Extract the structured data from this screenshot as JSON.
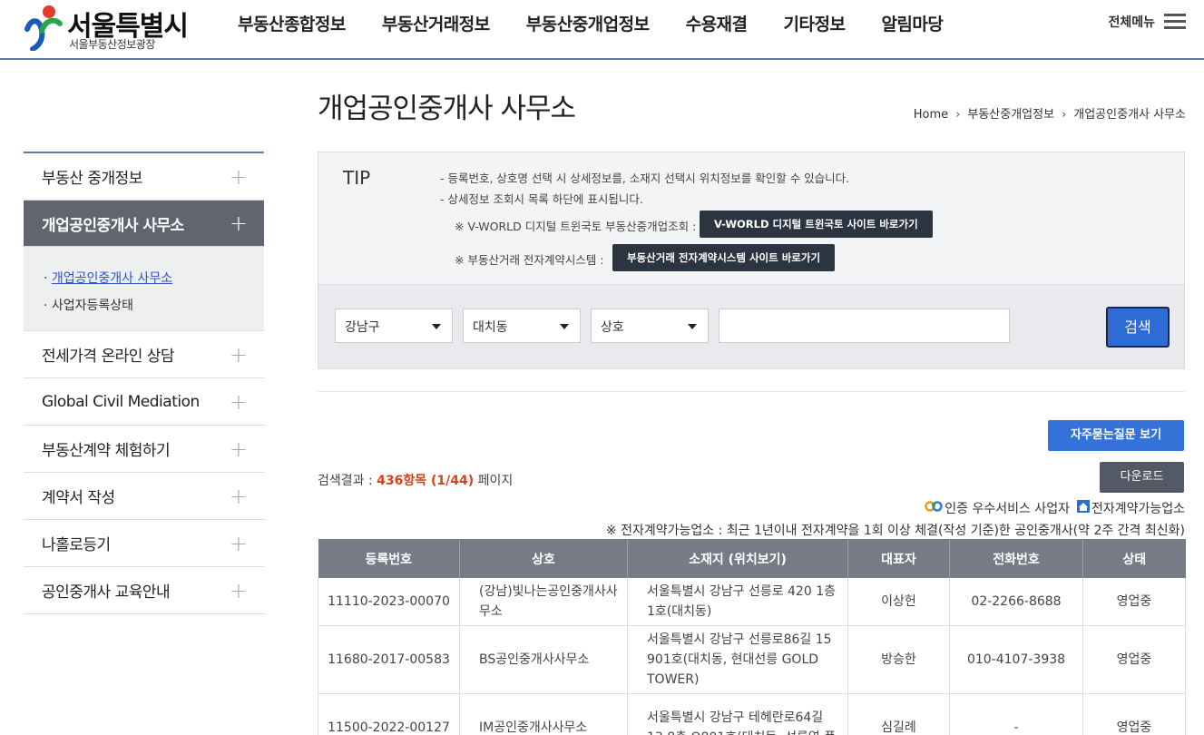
{
  "header": {
    "logo_title": "서울특별시",
    "logo_sub": "서울부동산정보광장",
    "nav": [
      "부동산종합정보",
      "부동산거래정보",
      "부동산중개업정보",
      "수용재결",
      "기타정보",
      "알림마당"
    ],
    "all_menu": "전체메뉴"
  },
  "sidebar": {
    "items": [
      {
        "label": "부동산 중개정보"
      },
      {
        "label": "개업공인중개사 사무소"
      },
      {
        "label": "전세가격 온라인 상담"
      },
      {
        "label": "Global Civil Mediation"
      },
      {
        "label": "부동산계약 체험하기"
      },
      {
        "label": "계약서 작성"
      },
      {
        "label": "나홀로등기"
      },
      {
        "label": "공인중개사 교육안내"
      }
    ],
    "sub_items": [
      "개업공인중개사 사무소",
      "사업자등록상태"
    ]
  },
  "page": {
    "title": "개업공인중개사 사무소",
    "breadcrumb": [
      "Home",
      "부동산중개업정보",
      "개업공인중개사 사무소"
    ]
  },
  "tip": {
    "label": "TIP",
    "line1": "-  등록번호, 상호명 선택 시 상세정보를, 소재지 선택시 위치정보를 확인할 수 있습니다.",
    "line2": "-  상세정보 조회시 목록 하단에 표시됩니다.",
    "note1": "※ V-WORLD 디지털 트윈국토 부동산중개업조회 :",
    "btn1": "V-WORLD 디지털 트윈국토 사이트 바로가기",
    "note2": "※ 부동산거래 전자계약시스템 :",
    "btn2": "부동산거래 전자계약시스템 사이트 바로가기"
  },
  "search": {
    "district": "강남구",
    "dong": "대치동",
    "type": "상호",
    "keyword": "",
    "button": "검색"
  },
  "faq_button": "자주묻는질문 보기",
  "result": {
    "prefix": "검색결과 : ",
    "count": "436항목 (1/44)",
    "suffix": " 페이지"
  },
  "download_button": "다운로드",
  "legend": {
    "cert": "인증 우수서비스 사업자",
    "econtract": "전자계약가능업소"
  },
  "notice": "※ 전자계약가능업소 : 최근 1년이내 전자계약을 1회 이상 체결(작성 기준)한 공인중개사(약 2주 간격 최신화)",
  "table": {
    "headers": [
      "등록번호",
      "상호",
      "소재지 (위치보기)",
      "대표자",
      "전화번호",
      "상태"
    ],
    "rows": [
      [
        "11110-2023-00070",
        "(강남)빛나는공인중개사사무소",
        "서울특별시 강남구 선릉로 420 1층 1호(대치동)",
        "이상헌",
        "02-2266-8688",
        "영업중"
      ],
      [
        "11680-2017-00583",
        "BS공인중개사사무소",
        "서울특별시 강남구 선릉로86길 15 901호(대치동, 현대선릉 GOLD TOWER)",
        "방승한",
        "010-4107-3938",
        "영업중"
      ],
      [
        "11500-2022-00127",
        "IM공인중개사사무소",
        "서울특별시 강남구 테헤란로64길 13 8층 O801호(대치동, 선릉역 풍",
        "심길례",
        "-",
        "영업중"
      ]
    ]
  },
  "colors": {
    "accent": "#3472d9",
    "active_nav_bg": "#606570",
    "table_header_bg": "#767b86",
    "count": "#d0451b"
  }
}
